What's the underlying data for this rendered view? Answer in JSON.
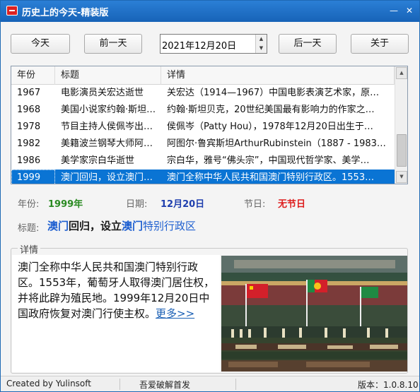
{
  "window": {
    "title": "历史上的今天-精装版",
    "minimize_glyph": "—",
    "close_glyph": "✕"
  },
  "toolbar": {
    "today_label": "今天",
    "prev_label": "前一天",
    "date_value": "2021年12月20日",
    "next_label": "后一天",
    "about_label": "关于"
  },
  "table": {
    "headers": [
      "年份",
      "标题",
      "详情"
    ],
    "rows": [
      [
        "1967",
        "电影演员关宏达逝世",
        "关宏达（1914—1967）中国电影表演艺术家，原…"
      ],
      [
        "1968",
        "美国小说家约翰·斯坦…",
        "约翰·斯坦贝克，20世纪美国最有影响力的作家之…"
      ],
      [
        "1978",
        "节目主持人侯佩岑出…",
        "侯佩岑（Patty Hou），1978年12月20日出生于…"
      ],
      [
        "1982",
        "美籍波兰钢琴大师阿…",
        "阿图尔·鲁宾斯坦ArthurRubinstein（1887 - 1983…"
      ],
      [
        "1986",
        "美学家宗白华逝世",
        "宗白华，雅号“佛头宗”，中国现代哲学家、美学…"
      ],
      [
        "1999",
        "澳门回归，设立澳门…",
        "澳门全称中华人民共和国澳门特别行政区。1553…"
      ]
    ],
    "selected_index": 5
  },
  "info": {
    "year_label": "年份:",
    "year_value": "1999年",
    "date_label": "日期:",
    "date_value": "12月20日",
    "festival_label": "节日:",
    "festival_value": "无节日",
    "title_label": "标题:",
    "title_parts": [
      "澳门",
      "回归，设立",
      "澳门",
      "特别行政区"
    ]
  },
  "details": {
    "legend": "详情",
    "text": "澳门全称中华人民共和国澳门特别行政区。1553年，葡萄牙人取得澳门居住权，并将此辟为殖民地。1999年12月20日中国政府恢复对澳门行使主权。",
    "more_link": "更多>>"
  },
  "statusbar": {
    "author": "Created by Yulinsoft",
    "release": "吾爱破解首发",
    "version": "版本：1.0.8.10"
  },
  "colors": {
    "titlebar": "#1e69b4",
    "selected_row": "#0a74d4",
    "year_value": "#2a8a22",
    "date_value": "#1f3fae",
    "festival_value": "#dd1d1d",
    "link": "#1a5fb4"
  },
  "icons": {
    "app": "app-logo-icon",
    "minimize": "minimize-icon",
    "close": "close-icon",
    "spin": "spin-arrows-icon",
    "scroll_up": "scroll-up-icon",
    "scroll_down": "scroll-down-icon"
  }
}
